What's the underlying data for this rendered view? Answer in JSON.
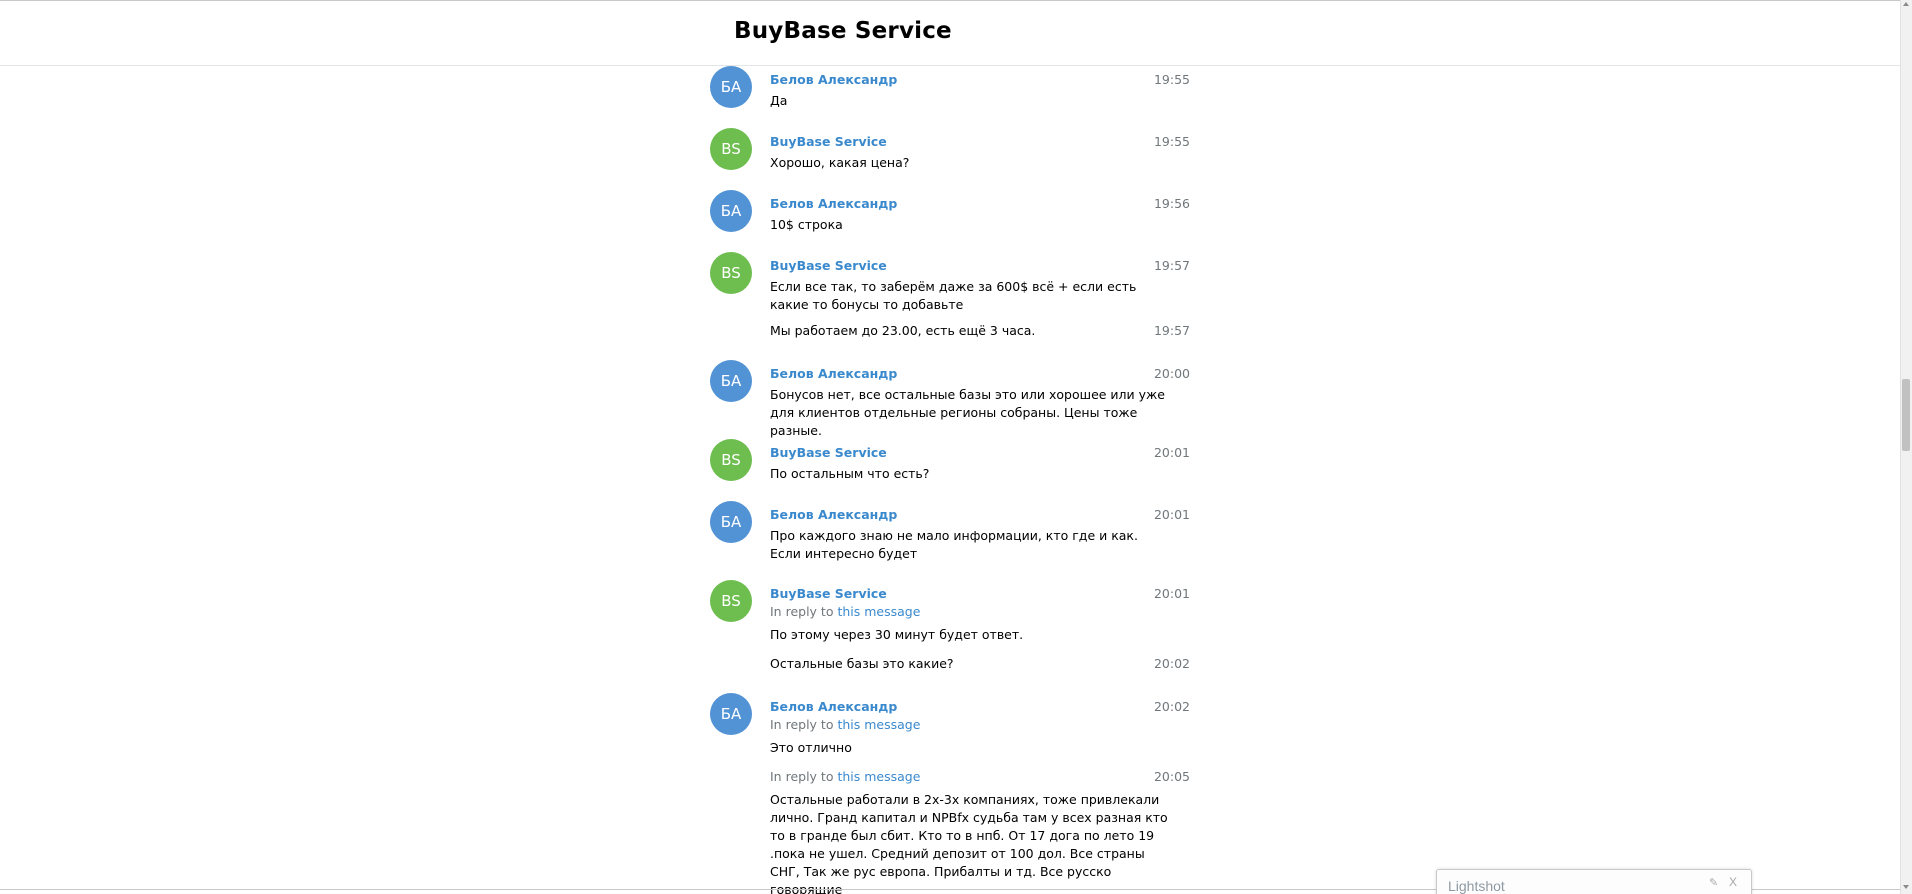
{
  "header": {
    "title": "BuyBase Service"
  },
  "reply_prefix": "In reply to ",
  "reply_link": "this message",
  "lightshot": {
    "label": "Lightshot",
    "close": "X"
  },
  "colors": {
    "blue_avatar": "#5293d5",
    "green_avatar": "#6dbd4f",
    "name_link": "#3a89cd"
  },
  "messages": [
    {
      "initials": "БА",
      "from": "Белов Александр",
      "time": "19:55",
      "text": "Да"
    },
    {
      "initials": "BS",
      "from": "BuyBase Service",
      "time": "19:55",
      "text": "Хорошо, какая цена?"
    },
    {
      "initials": "БА",
      "from": "Белов Александр",
      "time": "19:56",
      "text": "10$ строка"
    },
    {
      "initials": "BS",
      "from": "BuyBase Service",
      "time": "19:57",
      "text": "Если все так, то заберём даже за 600$ всё + если есть какие то бонусы то добавьте"
    },
    {
      "time": "19:57",
      "text": "Мы работаем до 23.00, есть ещё 3 часа."
    },
    {
      "initials": "БА",
      "from": "Белов Александр",
      "time": "20:00",
      "text": "Бонусов нет, все остальные базы это или хорошее или уже для клиентов отдельные регионы собраны. Цены тоже разные."
    },
    {
      "initials": "BS",
      "from": "BuyBase Service",
      "time": "20:01",
      "text": "По остальным что есть?"
    },
    {
      "initials": "БА",
      "from": "Белов Александр",
      "time": "20:01",
      "text": "Про каждого знаю не мало информации, кто где и как. Если интересно будет"
    },
    {
      "initials": "BS",
      "from": "BuyBase Service",
      "time": "20:01",
      "text": "По этому через 30 минут будет ответ."
    },
    {
      "time": "20:02",
      "text": "Остальные базы это какие?"
    },
    {
      "initials": "БА",
      "from": "Белов Александр",
      "time": "20:02",
      "text": "Это отлично"
    },
    {
      "time": "20:05",
      "text": "Остальные работали в 2х-3х компаниях, тоже привлекали лично. Гранд капитал и NPBfx судьба там у всех разная кто то в гранде был сбит. Кто то в нпб. От 17 дога по лето 19 .пока не ушел. Средний депозит от 100 дол. Все страны СНГ, Так же рус европа. Прибалты и тд. Все русско говорящие"
    }
  ]
}
